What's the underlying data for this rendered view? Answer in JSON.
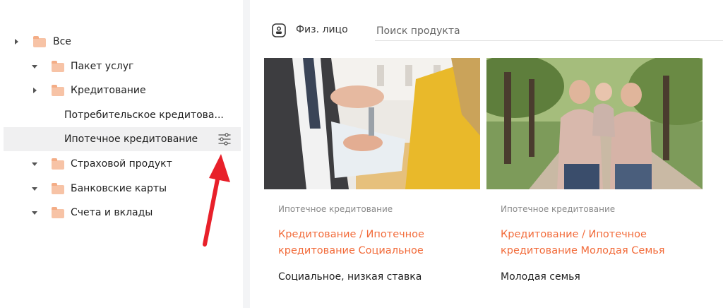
{
  "sidebar": {
    "items": [
      {
        "label": "Все"
      },
      {
        "label": "Пакет услуг"
      },
      {
        "label": "Кредитование"
      },
      {
        "label": "Потребительское кредитова..."
      },
      {
        "label": "Ипотечное кредитование"
      },
      {
        "label": "Страховой продукт"
      },
      {
        "label": "Банковские карты"
      },
      {
        "label": "Счета и вклады"
      }
    ]
  },
  "header": {
    "client_type": "Физ. лицо",
    "search_placeholder": "Поиск продукта"
  },
  "cards": [
    {
      "category": "Ипотечное кредитование",
      "title": "Кредитование / Ипотечное кредитование Социальное",
      "subtitle": "Социальное, низкая ставка"
    },
    {
      "category": "Ипотечное кредитование",
      "title": "Кредитование / Ипотечное кредитование Молодая Семья",
      "subtitle": "Молодая семья"
    }
  ],
  "colors": {
    "accent": "#f26b3a",
    "folder": "#f7c3a6",
    "annotation_arrow": "#e8202a",
    "selected_row": "#f0f0f1"
  },
  "icons": [
    "caret-right-icon",
    "caret-down-icon",
    "folder-icon",
    "settings-sliders-icon",
    "person-badge-icon"
  ]
}
